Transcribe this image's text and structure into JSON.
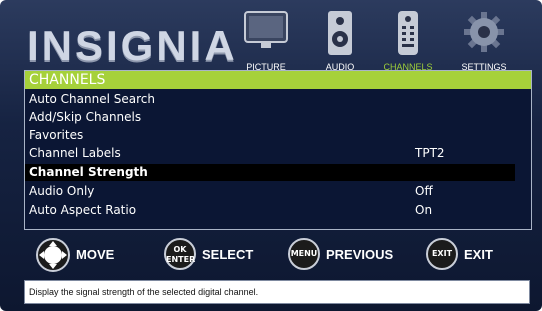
{
  "brand": {
    "logo_text": "INSIGNIA"
  },
  "tabs": [
    {
      "label": "PICTURE",
      "icon": "tv-icon",
      "active": false
    },
    {
      "label": "AUDIO",
      "icon": "speaker-icon",
      "active": false
    },
    {
      "label": "CHANNELS",
      "icon": "remote-icon",
      "active": true
    },
    {
      "label": "SETTINGS",
      "icon": "gear-icon",
      "active": false
    }
  ],
  "menu": {
    "title": "CHANNELS",
    "items": [
      {
        "label": "Auto Channel Search",
        "value": ""
      },
      {
        "label": "Add/Skip Channels",
        "value": ""
      },
      {
        "label": "Favorites",
        "value": ""
      },
      {
        "label": "Channel Labels",
        "value": "TPT2"
      },
      {
        "label": "Channel Strength",
        "value": "",
        "selected": true
      },
      {
        "label": "Audio Only",
        "value": "Off"
      },
      {
        "label": "Auto Aspect Ratio",
        "value": "On"
      }
    ]
  },
  "controls": [
    {
      "button": "",
      "label": "MOVE"
    },
    {
      "button": "OK ENTER",
      "label": "SELECT"
    },
    {
      "button": "MENU",
      "label": "PREVIOUS"
    },
    {
      "button": "EXIT",
      "label": "EXIT"
    }
  ],
  "description": "Display the signal strength of the selected digital channel.",
  "colors": {
    "highlight": "#a6d13a",
    "background": "#162342",
    "active_tab": "#9ecf3a"
  }
}
